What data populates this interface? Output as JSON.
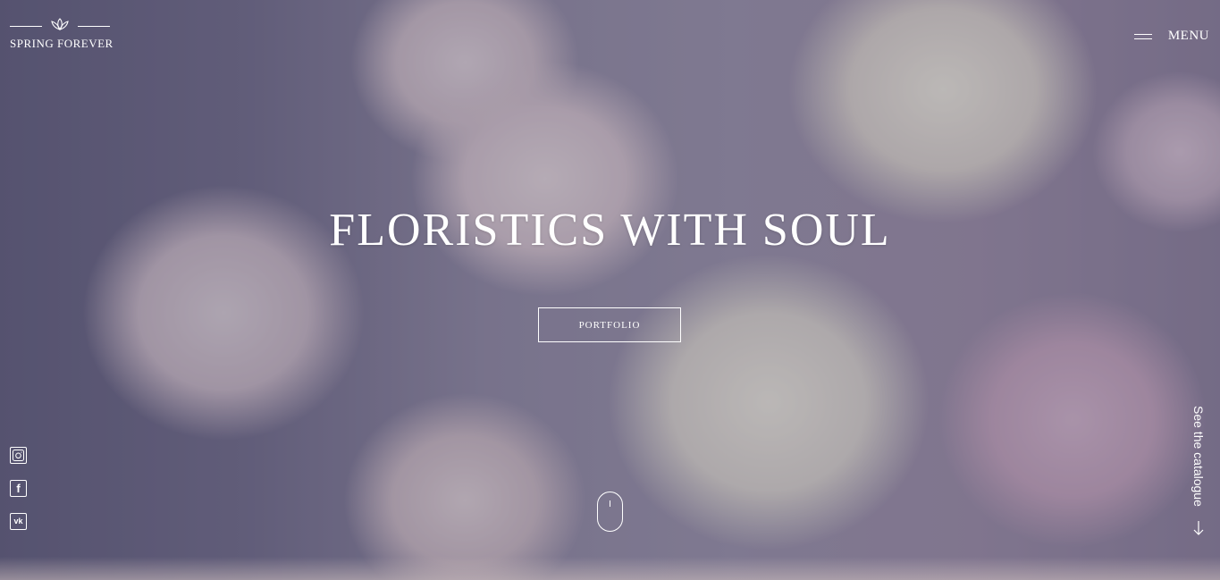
{
  "brand": {
    "name": "SPRING FOREVER",
    "icon": "lotus-icon"
  },
  "nav": {
    "menu_label": "MENU",
    "menu_icon": "hamburger-icon"
  },
  "hero": {
    "headline": "FLORISTICS WITH SOUL",
    "cta_label": "PORTFOLIO"
  },
  "socials": [
    {
      "name": "instagram-icon"
    },
    {
      "name": "facebook-icon",
      "glyph": "f"
    },
    {
      "name": "vk-icon",
      "glyph": "vk"
    }
  ],
  "scroll_indicator": {
    "icon": "mouse-scroll-icon"
  },
  "catalogue_link": {
    "label": "See the catalogue",
    "icon": "arrow-down-icon"
  },
  "colors": {
    "text": "#ffffff",
    "overlay": "#5f5e78"
  }
}
